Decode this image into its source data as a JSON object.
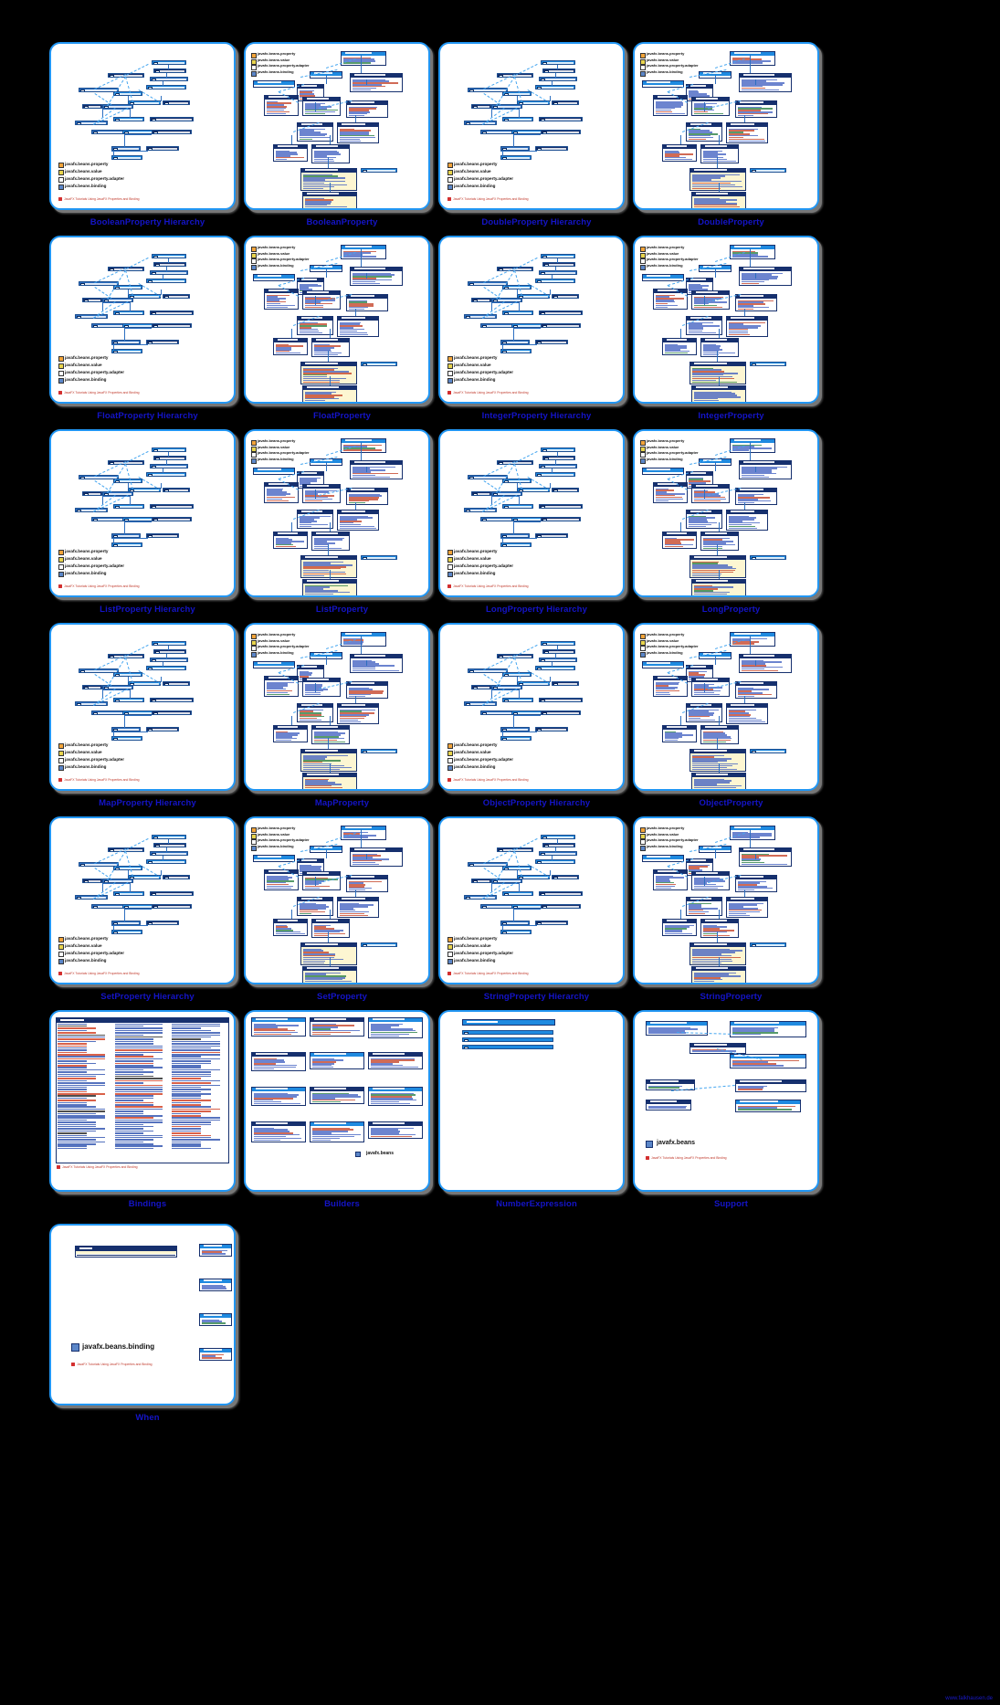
{
  "page": {
    "background": "#000000",
    "accent": "#2196F3",
    "caption_color": "#1414c8",
    "watermark": "www.falkhausen.de"
  },
  "legend": {
    "items": [
      {
        "label": "javafx.beans.property",
        "color": "#f2a43a"
      },
      {
        "label": "javafx.beans.value",
        "color": "#e8d44d"
      },
      {
        "label": "javafx.beans.property.adapter",
        "color": "#ffffff"
      },
      {
        "label": "javafx.beans.binding",
        "color": "#5b86c8"
      }
    ],
    "pdf_link": "JavaFX Tutorials Using JavaFX Properties and Binding"
  },
  "panels": [
    {
      "caption": "BooleanProperty Hierarchy",
      "kind": "hierarchy",
      "legend": true,
      "link": true
    },
    {
      "caption": "BooleanProperty",
      "kind": "detail",
      "legend_top": true
    },
    {
      "caption": "DoubleProperty Hierarchy",
      "kind": "hierarchy",
      "legend": true,
      "link": true
    },
    {
      "caption": "DoubleProperty",
      "kind": "detail",
      "legend_top": true
    },
    {
      "caption": "FloatProperty Hierarchy",
      "kind": "hierarchy",
      "legend": true,
      "link": true
    },
    {
      "caption": "FloatProperty",
      "kind": "detail",
      "legend_top": true
    },
    {
      "caption": "IntegerProperty Hierarchy",
      "kind": "hierarchy",
      "legend": true,
      "link": true
    },
    {
      "caption": "IntegerProperty",
      "kind": "detail",
      "legend_top": true
    },
    {
      "caption": "ListProperty Hierarchy",
      "kind": "hierarchy",
      "legend": true,
      "link": true
    },
    {
      "caption": "ListProperty",
      "kind": "detail",
      "legend_top": true
    },
    {
      "caption": "LongProperty Hierarchy",
      "kind": "hierarchy",
      "legend": true,
      "link": true
    },
    {
      "caption": "LongProperty",
      "kind": "detail",
      "legend_top": true
    },
    {
      "caption": "MapProperty Hierarchy",
      "kind": "hierarchy",
      "legend": true,
      "link": true
    },
    {
      "caption": "MapProperty",
      "kind": "detail",
      "legend_top": true
    },
    {
      "caption": "ObjectProperty Hierarchy",
      "kind": "hierarchy",
      "legend": true,
      "link": true
    },
    {
      "caption": "ObjectProperty",
      "kind": "detail",
      "legend_top": true
    },
    {
      "caption": "SetProperty Hierarchy",
      "kind": "hierarchy",
      "legend": true,
      "link": true
    },
    {
      "caption": "SetProperty",
      "kind": "detail",
      "legend_top": true
    },
    {
      "caption": "StringProperty Hierarchy",
      "kind": "hierarchy",
      "legend": true,
      "link": true
    },
    {
      "caption": "StringProperty",
      "kind": "detail",
      "legend_top": true
    },
    {
      "caption": "Bindings",
      "kind": "table3",
      "link": true
    },
    {
      "caption": "Builders",
      "kind": "builders"
    },
    {
      "caption": "NumberExpression",
      "kind": "numberexpr"
    },
    {
      "caption": "Support",
      "kind": "support",
      "package": "javafx.beans"
    },
    {
      "caption": "When",
      "kind": "when",
      "package": "javafx.beans.binding",
      "link": true
    }
  ],
  "nodes": {
    "hierarchy_primary": [
      "Observable",
      "ObservableValue",
      "ReadOnlyProperty",
      "WritableValue",
      "Property",
      "Binding",
      "ObservableBooleanValue",
      "WritableBooleanValue",
      "ReadOnlyBooleanProperty",
      "BooleanExpression",
      "BooleanProperty",
      "ReadOnlyBooleanWrapper",
      "SimpleBooleanProperty",
      "BooleanBinding",
      "BooleanPropertyBase",
      "ReadOnlyBooleanPropertyBase",
      "JavaBeanBooleanProperty"
    ]
  },
  "panel_titles": {
    "bindings_header": "Bindings",
    "when_header": "When",
    "when_subtitle": "When (ObservableBooleanValue condition)"
  }
}
